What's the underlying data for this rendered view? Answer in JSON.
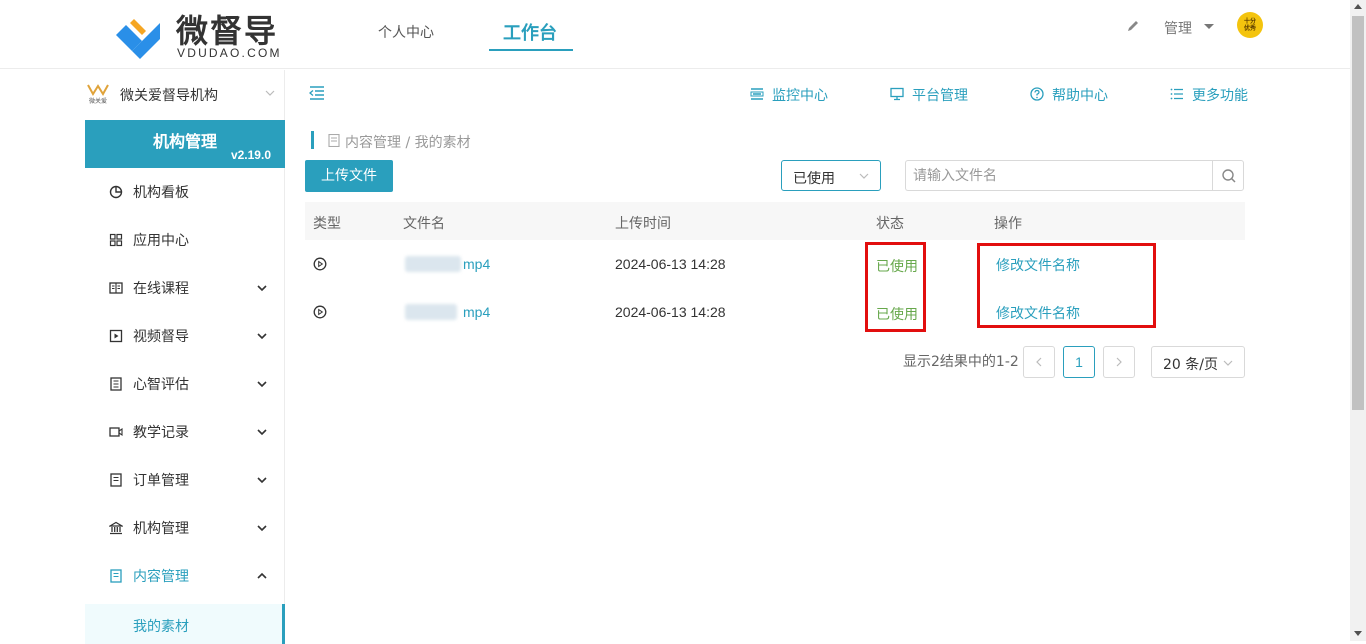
{
  "header": {
    "logo_name": "微督导",
    "logo_sub": "VDUDAO.COM",
    "tabs": [
      {
        "label": "个人中心"
      },
      {
        "label": "工作台"
      }
    ],
    "admin_label": "管理",
    "avatar_text_1": "十分",
    "avatar_text_2": "优秀"
  },
  "colors": {
    "accent": "#2a9fbd",
    "status_green": "#67a84c",
    "highlight_red": "#e20e0e"
  },
  "sidebar": {
    "org_name": "微关爱督导机构",
    "org_logo_text": "微关爱",
    "banner_title": "机构管理",
    "version": "v2.19.0",
    "items": [
      {
        "label": "机构看板",
        "icon": "pie-chart-icon"
      },
      {
        "label": "应用中心",
        "icon": "grid-icon"
      },
      {
        "label": "在线课程",
        "icon": "book-icon"
      },
      {
        "label": "视频督导",
        "icon": "play-square-icon"
      },
      {
        "label": "心智评估",
        "icon": "file-list-icon"
      },
      {
        "label": "教学记录",
        "icon": "video-camera-icon"
      },
      {
        "label": "订单管理",
        "icon": "document-icon"
      },
      {
        "label": "机构管理",
        "icon": "bank-icon"
      },
      {
        "label": "内容管理",
        "icon": "document-icon"
      }
    ],
    "sub_active": "我的素材"
  },
  "toolbar": {
    "links": [
      {
        "label": "监控中心",
        "icon": "monitor-list-icon"
      },
      {
        "label": "平台管理",
        "icon": "desktop-icon"
      },
      {
        "label": "帮助中心",
        "icon": "question-circle-icon"
      },
      {
        "label": "更多功能",
        "icon": "list-icon"
      }
    ]
  },
  "breadcrumb": "内容管理 / 我的素材",
  "actions": {
    "upload_label": "上传文件",
    "status_filter": "已使用",
    "search_placeholder": "请输入文件名"
  },
  "table": {
    "headers": [
      "类型",
      "文件名",
      "上传时间",
      "状态",
      "操作"
    ],
    "rows": [
      {
        "type_icon": "play-circle-icon",
        "name": "mp4",
        "time": "2024-06-13 14:28",
        "status": "已使用",
        "action": "修改文件名称"
      },
      {
        "type_icon": "play-circle-icon",
        "name": "mp4",
        "time": "2024-06-13 14:28",
        "status": "已使用",
        "action": "修改文件名称"
      }
    ]
  },
  "pagination": {
    "summary": "显示2结果中的1-2",
    "current_page": "1",
    "page_size": "20 条/页"
  }
}
